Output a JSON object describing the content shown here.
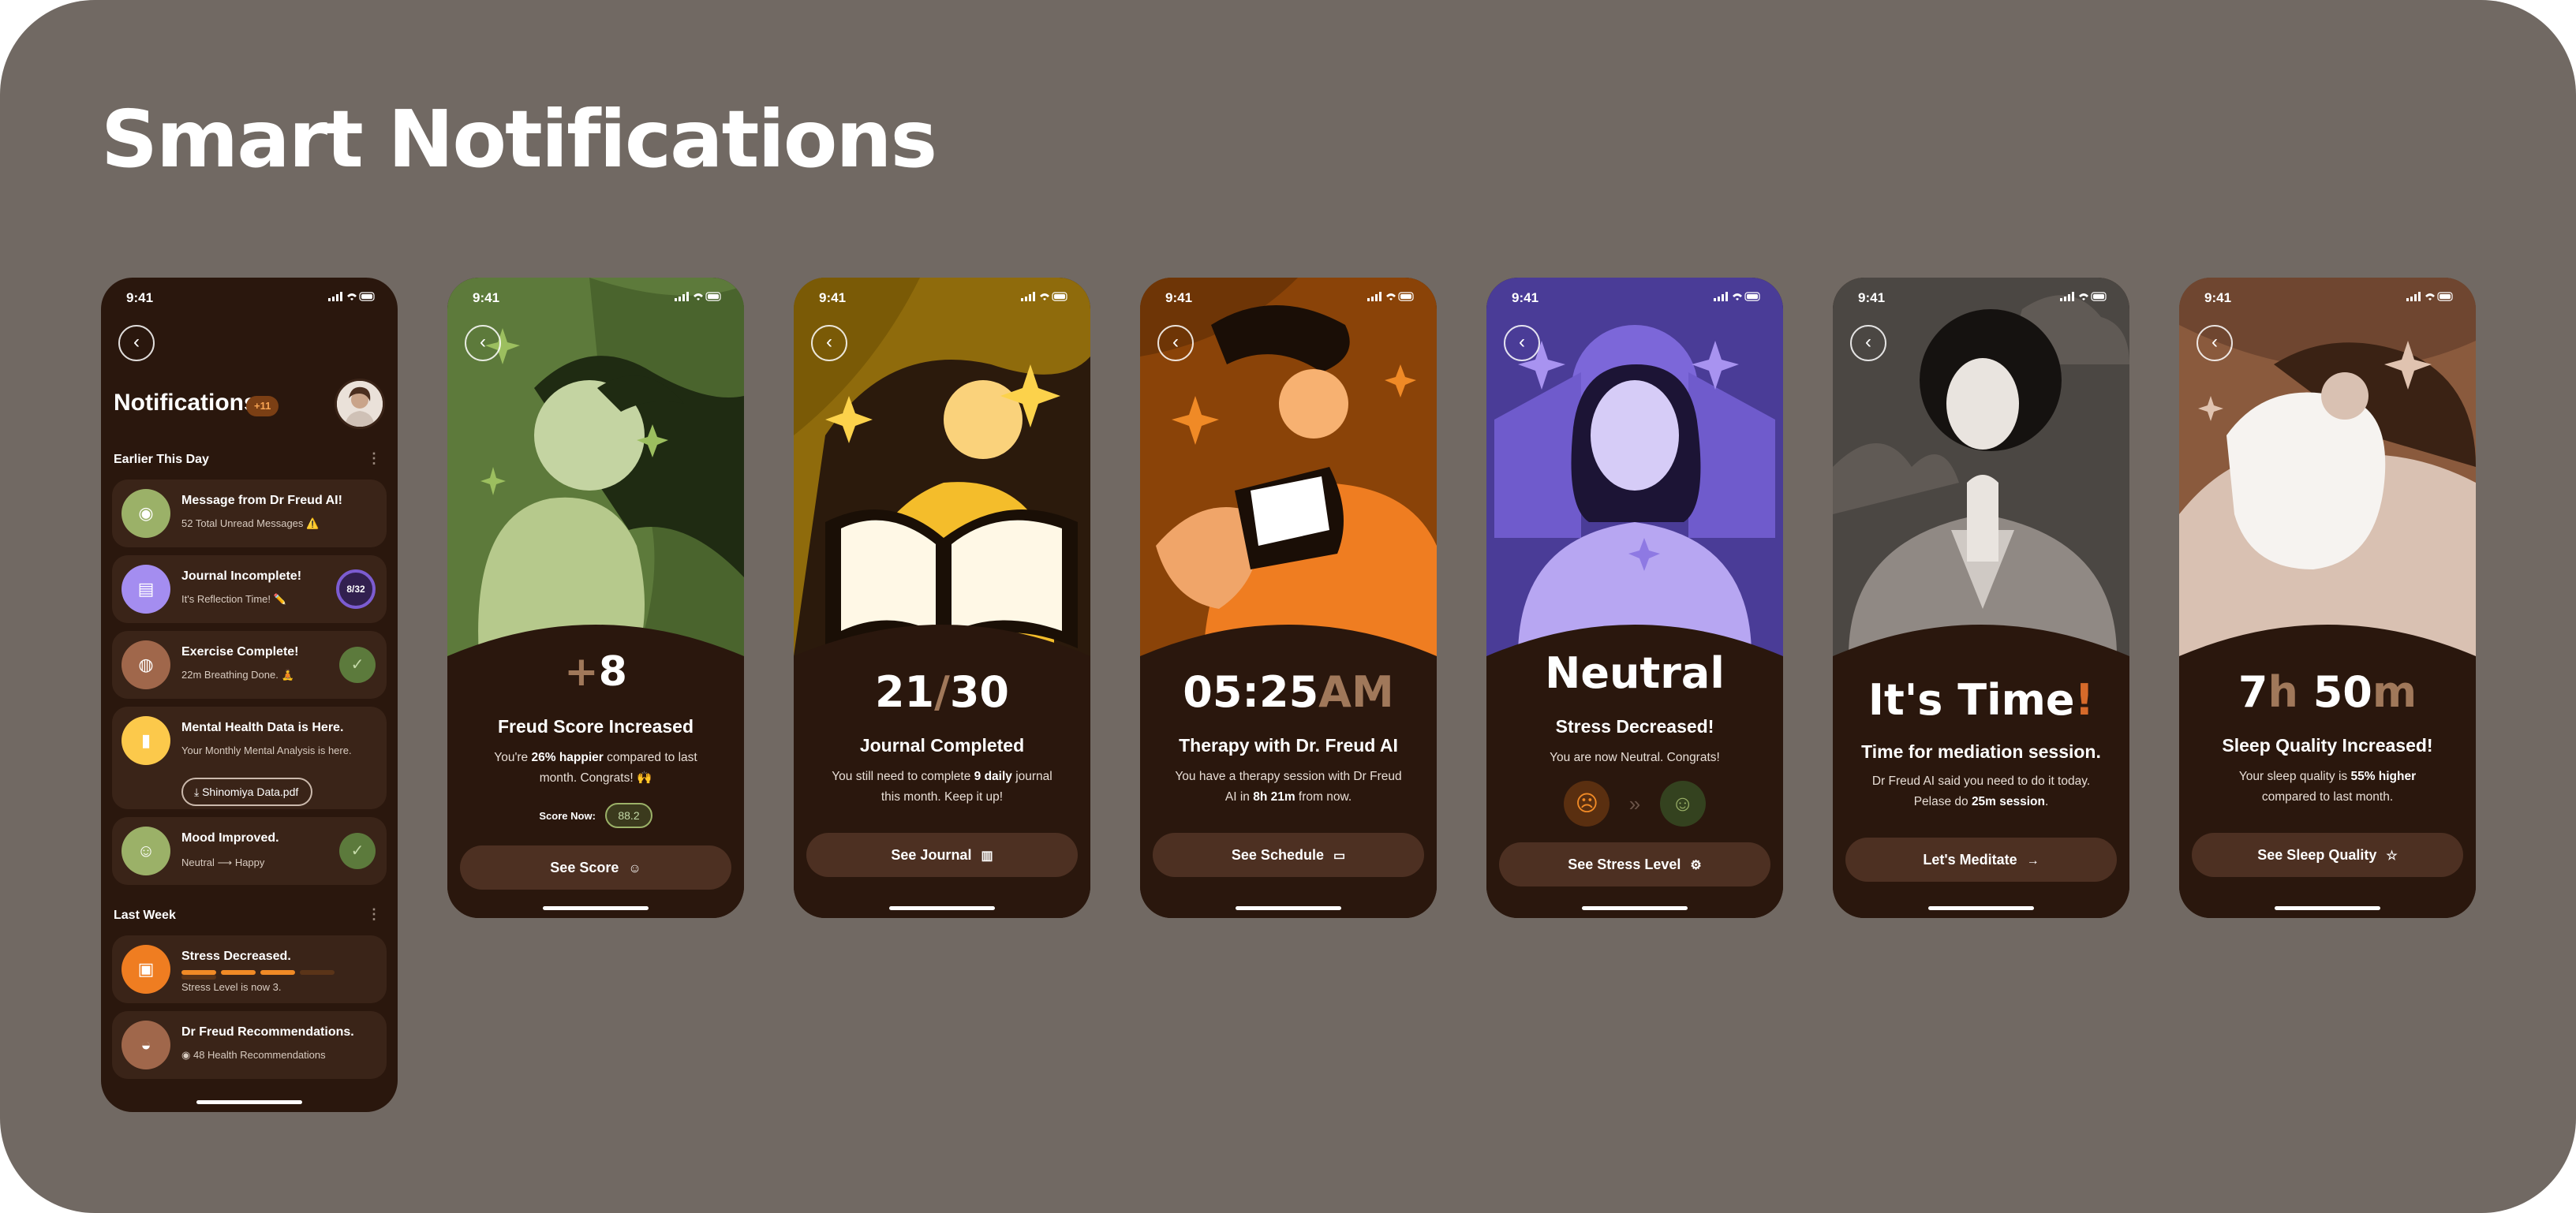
{
  "page": {
    "title": "Smart Notifications"
  },
  "status_time": "9:41",
  "notifications": {
    "title": "Notifications",
    "badge": "+11",
    "earlier_label": "Earlier This Day",
    "last_week_label": "Last Week",
    "dots": "⋮",
    "items": [
      {
        "title": "Message from Dr Freud AI!",
        "sub": "52 Total Unread Messages ⚠️",
        "color": "#9bb168",
        "icon": "chat-icon",
        "glyph": "◉"
      },
      {
        "title": "Journal Incomplete!",
        "sub": "It's Reflection Time! ✏️",
        "color": "#a48df0",
        "icon": "journal-icon",
        "glyph": "▤",
        "progress": "8/32"
      },
      {
        "title": "Exercise Complete!",
        "sub": "22m Breathing Done. 🧘",
        "color": "#a0674b",
        "icon": "mind-icon",
        "glyph": "◍"
      },
      {
        "title": "Mental Health Data is Here.",
        "sub": "Your Monthly Mental Analysis is here.",
        "color": "#fcc94b",
        "icon": "bar-chart-icon",
        "glyph": "▮",
        "file": "Shinomiya Data.pdf"
      },
      {
        "title": "Mood Improved.",
        "sub_from": "Neutral",
        "sub_to": "Happy",
        "color": "#9bb168",
        "icon": "smile-icon",
        "glyph": "☺"
      }
    ],
    "last_week": [
      {
        "title": "Stress Decreased.",
        "sub": "Stress Level is now 3.",
        "color": "#ef7d21",
        "icon": "stress-icon",
        "glyph": "▣",
        "level": 3,
        "max": 5
      },
      {
        "title": "Dr Freud Recommendations.",
        "sub": "48 Health Recommendations",
        "color": "#a0674b",
        "icon": "brain-icon",
        "glyph": "◒"
      }
    ]
  },
  "screens": [
    {
      "big_accent": "+",
      "big_main": "8",
      "title": "Freud Score Increased",
      "body_a": "You're ",
      "body_b": "26% happier",
      "body_c": " compared to last month. Congrats! 🙌",
      "score_label": "Score Now:",
      "score_value": "88.2",
      "cta": "See Score",
      "cta_icon": "☺"
    },
    {
      "big_main": "21",
      "big_accent": "/",
      "big_tail": "30",
      "title": "Journal Completed",
      "body_a": "You still need to complete ",
      "body_b": "9 daily",
      "body_c": " journal this month. Keep it up!",
      "cta": "See Journal",
      "cta_icon": "▥"
    },
    {
      "big_main": "05:25",
      "big_accent": "AM",
      "title": "Therapy with Dr. Freud AI",
      "body_a": "You have a therapy session with Dr Freud AI in ",
      "body_b": "8h 21m",
      "body_c": " from now.",
      "cta": "See Schedule",
      "cta_icon": "▭"
    },
    {
      "big_main": "Neutral",
      "title": "Stress Decreased!",
      "body_a": "You are now Neutral. Congrats!",
      "mood_from": "☹",
      "mood_to": "☺",
      "mood_arrow": "»",
      "cta": "See Stress Level",
      "cta_icon": "⚙"
    },
    {
      "big_main": "It's Time",
      "big_accent": "!",
      "title": "Time for mediation session.",
      "body_a": "Dr Freud AI said you need to do it today. Pelase do ",
      "body_b": "25m session",
      "body_c": ".",
      "cta": "Let's Meditate",
      "cta_icon": "→"
    },
    {
      "big_main": "7",
      "big_accent": "h",
      "big_tail": " 50",
      "big_accent2": "m",
      "title": "Sleep Quality Increased!",
      "body_a": "Your sleep quality is ",
      "body_b": "55% higher",
      "body_c": " compared to last month.",
      "cta": "See Sleep Quality",
      "cta_icon": "☆"
    }
  ]
}
